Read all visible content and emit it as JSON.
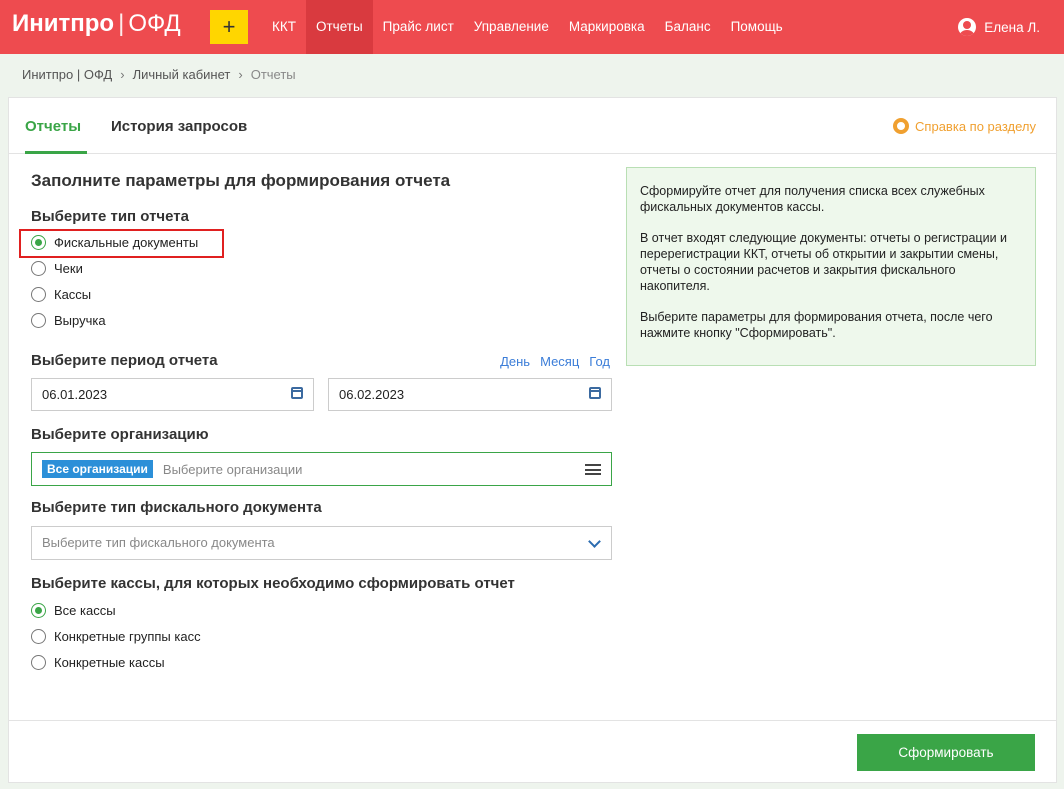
{
  "header": {
    "logo_brand": "Инитпро",
    "logo_separator": "|",
    "logo_product": "ОФД",
    "add_label": "+",
    "nav": [
      {
        "label": "ККТ",
        "active": false
      },
      {
        "label": "Отчеты",
        "active": true
      },
      {
        "label": "Прайс лист",
        "active": false
      },
      {
        "label": "Управление",
        "active": false
      },
      {
        "label": "Маркировка",
        "active": false
      },
      {
        "label": "Баланс",
        "active": false
      },
      {
        "label": "Помощь",
        "active": false
      }
    ],
    "user_name": "Елена Л."
  },
  "breadcrumb": {
    "items": [
      "Инитпро | ОФД",
      "Личный кабинет",
      "Отчеты"
    ],
    "separator": "›"
  },
  "tabs": {
    "items": [
      "Отчеты",
      "История запросов"
    ],
    "help_link": "Справка по разделу"
  },
  "form": {
    "title": "Заполните параметры для формирования отчета",
    "report_type": {
      "label": "Выберите тип отчета",
      "options": [
        "Фискальные документы",
        "Чеки",
        "Кассы",
        "Выручка"
      ],
      "selected": "Фискальные документы"
    },
    "period": {
      "label": "Выберите период отчета",
      "quick": [
        "День",
        "Месяц",
        "Год"
      ],
      "date_from": "06.01.2023",
      "date_to": "06.02.2023"
    },
    "organization": {
      "label": "Выберите организацию",
      "chip": "Все организации",
      "placeholder": "Выберите организации"
    },
    "fiscal_doc_type": {
      "label": "Выберите тип фискального документа",
      "placeholder": "Выберите тип фискального документа"
    },
    "registers": {
      "label": "Выберите кассы, для которых необходимо сформировать отчет",
      "options": [
        "Все кассы",
        "Конкретные группы касс",
        "Конкретные кассы"
      ],
      "selected": "Все кассы"
    },
    "submit_label": "Сформировать"
  },
  "info": {
    "paragraphs": [
      "Сформируйте отчет для получения списка всех служебных фискальных документов кассы.",
      "В отчет входят следующие документы: отчеты о регистрации и перерегистрации ККТ, отчеты об открытии и закрытии смены, отчеты о состоянии расчетов и закрытия фискального накопителя.",
      "Выберите параметры для формирования отчета, после чего нажмите кнопку \"Сформировать\"."
    ]
  },
  "colors": {
    "header_bg": "#ee4b4f",
    "accent_green": "#3aa547",
    "link_blue": "#3b7dd8",
    "help_orange": "#f0a030",
    "highlight_red": "#e02020"
  }
}
